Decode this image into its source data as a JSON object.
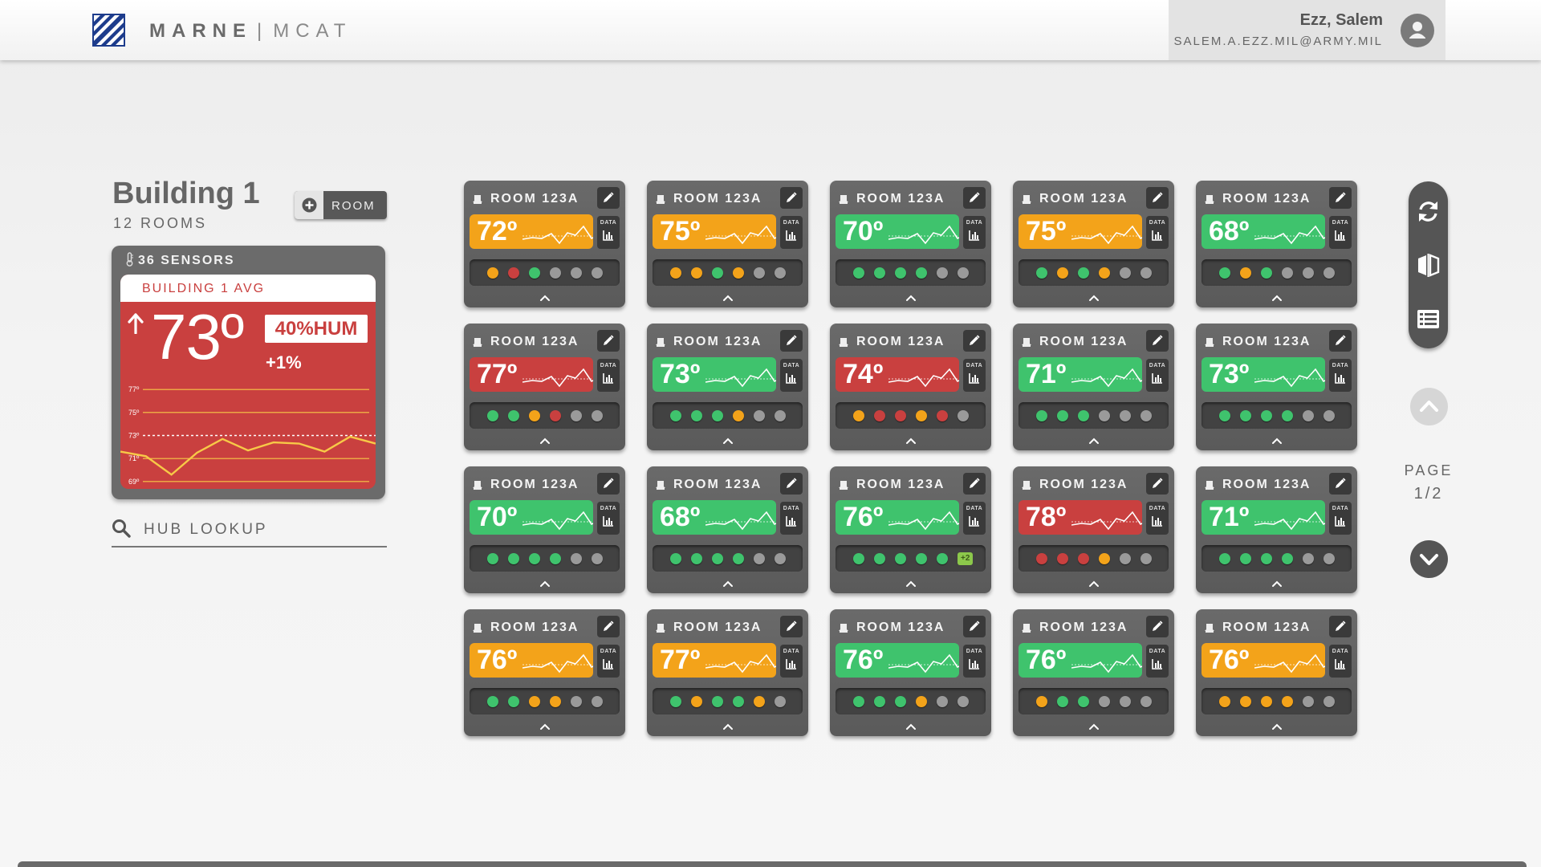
{
  "header": {
    "brand_primary": "MARNE",
    "brand_separator": "|",
    "brand_secondary": "MCAT",
    "logo_icon": "marne-stripes-logo",
    "user_name": "Ezz, Salem",
    "user_email": "SALEM.A.EZZ.MIL@ARMY.MIL",
    "avatar_icon": "user-avatar-icon"
  },
  "building": {
    "title": "Building 1",
    "rooms_label": "12 ROOMS",
    "add_room_label": "ROOM",
    "sensors_label": "36 SENSORS",
    "avg_label": "BUILDING 1 AVG",
    "avg_temp": "73º",
    "humidity": "40%HUM",
    "change": "+1%",
    "trend_icon": "arrow-up-icon"
  },
  "avg_chart": {
    "y_ticks": [
      "77º",
      "75º",
      "73º",
      "71º",
      "69º"
    ],
    "series": [
      71.6,
      71.2,
      69.6,
      71.5,
      72.7,
      71.7,
      72.4,
      72.3,
      71.6,
      72.9,
      72.3
    ],
    "avg_line": 73,
    "ylim": [
      68.5,
      77.5
    ]
  },
  "search": {
    "placeholder": "HUB LOOKUP"
  },
  "status_colors": {
    "green": "#3fc36d",
    "orange": "#f3a31a",
    "red": "#c9403f",
    "gray": "#9a9a9a"
  },
  "rooms": [
    {
      "name": "ROOM 123A",
      "temp": "72º",
      "status": "orange",
      "sensors": [
        "orange",
        "red",
        "green",
        "gray",
        "gray",
        "gray"
      ]
    },
    {
      "name": "ROOM 123A",
      "temp": "75º",
      "status": "orange",
      "sensors": [
        "orange",
        "orange",
        "green",
        "orange",
        "gray",
        "gray"
      ]
    },
    {
      "name": "ROOM 123A",
      "temp": "70º",
      "status": "green",
      "sensors": [
        "green",
        "green",
        "green",
        "green",
        "gray",
        "gray"
      ]
    },
    {
      "name": "ROOM 123A",
      "temp": "75º",
      "status": "orange",
      "sensors": [
        "green",
        "orange",
        "green",
        "orange",
        "gray",
        "gray"
      ]
    },
    {
      "name": "ROOM 123A",
      "temp": "68º",
      "status": "green",
      "sensors": [
        "green",
        "orange",
        "green",
        "gray",
        "gray",
        "gray"
      ]
    },
    {
      "name": "ROOM 123A",
      "temp": "77º",
      "status": "red",
      "sensors": [
        "green",
        "green",
        "orange",
        "red",
        "gray",
        "gray"
      ]
    },
    {
      "name": "ROOM 123A",
      "temp": "73º",
      "status": "green",
      "sensors": [
        "green",
        "green",
        "green",
        "orange",
        "gray",
        "gray"
      ]
    },
    {
      "name": "ROOM 123A",
      "temp": "74º",
      "status": "red",
      "sensors": [
        "orange",
        "red",
        "red",
        "orange",
        "red",
        "gray"
      ]
    },
    {
      "name": "ROOM 123A",
      "temp": "71º",
      "status": "green",
      "sensors": [
        "green",
        "green",
        "green",
        "gray",
        "gray",
        "gray"
      ]
    },
    {
      "name": "ROOM 123A",
      "temp": "73º",
      "status": "green",
      "sensors": [
        "green",
        "green",
        "green",
        "green",
        "gray",
        "gray"
      ]
    },
    {
      "name": "ROOM 123A",
      "temp": "70º",
      "status": "green",
      "sensors": [
        "green",
        "green",
        "green",
        "green",
        "gray",
        "gray"
      ]
    },
    {
      "name": "ROOM 123A",
      "temp": "68º",
      "status": "green",
      "sensors": [
        "green",
        "green",
        "green",
        "green",
        "gray",
        "gray"
      ]
    },
    {
      "name": "ROOM 123A",
      "temp": "76º",
      "status": "green",
      "sensors": [
        "green",
        "green",
        "green",
        "green",
        "green"
      ],
      "extra": "+2"
    },
    {
      "name": "ROOM 123A",
      "temp": "78º",
      "status": "red",
      "sensors": [
        "red",
        "red",
        "red",
        "orange",
        "gray",
        "gray"
      ]
    },
    {
      "name": "ROOM 123A",
      "temp": "71º",
      "status": "green",
      "sensors": [
        "green",
        "green",
        "green",
        "green",
        "gray",
        "gray"
      ]
    },
    {
      "name": "ROOM 123A",
      "temp": "76º",
      "status": "orange",
      "sensors": [
        "green",
        "green",
        "orange",
        "orange",
        "gray",
        "gray"
      ]
    },
    {
      "name": "ROOM 123A",
      "temp": "77º",
      "status": "orange",
      "sensors": [
        "green",
        "orange",
        "green",
        "green",
        "orange",
        "gray"
      ]
    },
    {
      "name": "ROOM 123A",
      "temp": "76º",
      "status": "green",
      "sensors": [
        "green",
        "green",
        "green",
        "orange",
        "gray",
        "gray"
      ]
    },
    {
      "name": "ROOM 123A",
      "temp": "76º",
      "status": "green",
      "sensors": [
        "orange",
        "green",
        "green",
        "gray",
        "gray",
        "gray"
      ]
    },
    {
      "name": "ROOM 123A",
      "temp": "76º",
      "status": "orange",
      "sensors": [
        "orange",
        "orange",
        "orange",
        "orange",
        "gray",
        "gray"
      ]
    }
  ],
  "room_card": {
    "data_label": "DATA",
    "room_icon": "sensor-hub-icon",
    "edit_icon": "pencil-icon",
    "data_icon": "bar-chart-icon",
    "expand_icon": "chevron-up-icon"
  },
  "toolbar": {
    "refresh_icon": "refresh-icon",
    "compare_icon": "compare-icon",
    "list_icon": "list-icon"
  },
  "pagination": {
    "label": "PAGE",
    "current": 1,
    "total": 2,
    "display": "1/2"
  }
}
